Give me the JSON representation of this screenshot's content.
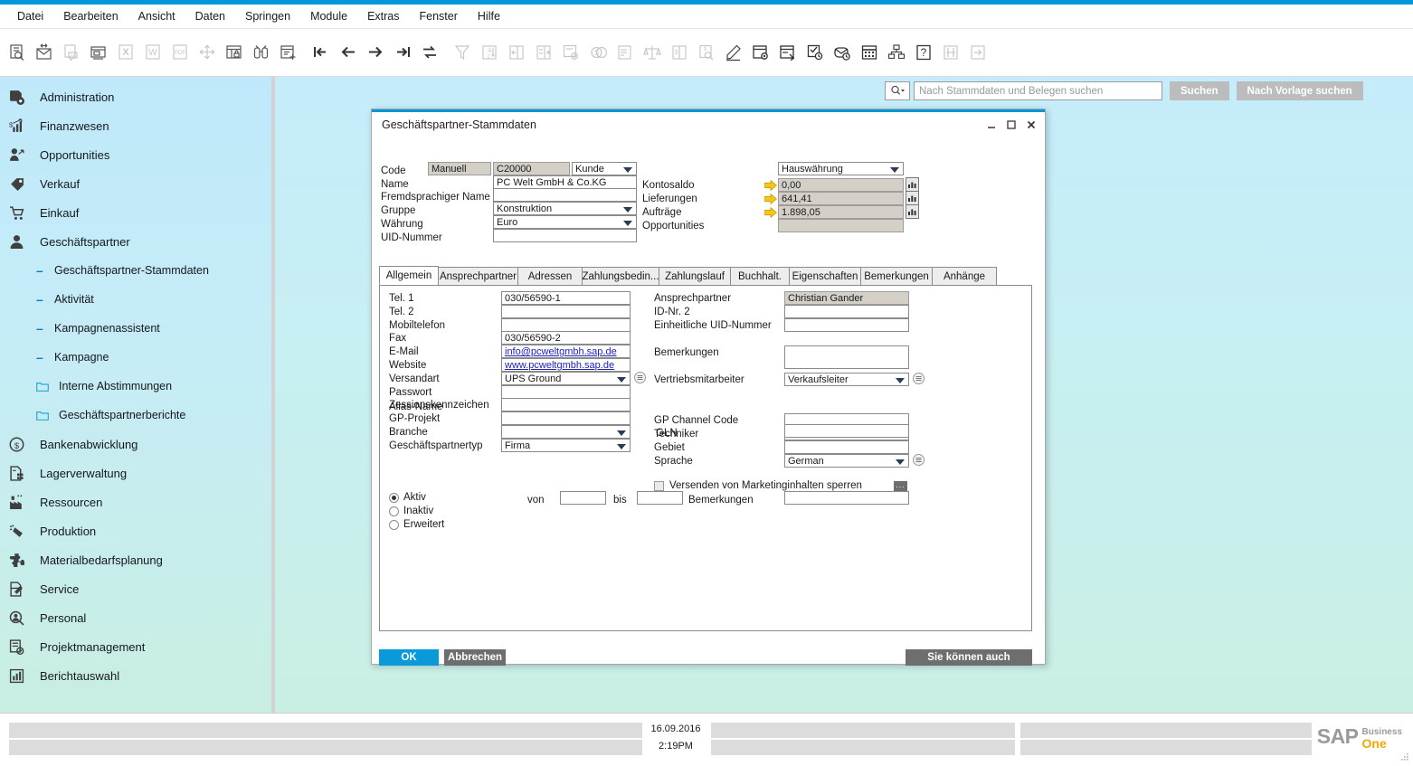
{
  "menubar": {
    "items": [
      "Datei",
      "Bearbeiten",
      "Ansicht",
      "Daten",
      "Springen",
      "Module",
      "Extras",
      "Fenster",
      "Hilfe"
    ]
  },
  "toolbar": {
    "icons": [
      {
        "name": "find-document-icon",
        "enabled": true
      },
      {
        "name": "mail-move-icon",
        "enabled": true
      },
      {
        "name": "message-document-icon",
        "enabled": false
      },
      {
        "name": "layers-window-icon",
        "enabled": true
      },
      {
        "name": "export-excel-icon",
        "enabled": false
      },
      {
        "name": "export-word-icon",
        "enabled": false
      },
      {
        "name": "export-pdf-icon",
        "enabled": false
      },
      {
        "name": "move-arrows-icon",
        "enabled": false
      },
      {
        "name": "lock-window-icon",
        "enabled": true
      },
      {
        "name": "binoculars-icon",
        "enabled": true
      },
      {
        "name": "add-document-icon",
        "enabled": true
      },
      {
        "name": "first-record-icon",
        "enabled": true
      },
      {
        "name": "previous-record-icon",
        "enabled": true
      },
      {
        "name": "next-record-icon",
        "enabled": true
      },
      {
        "name": "last-record-icon",
        "enabled": true
      },
      {
        "name": "refresh-swap-icon",
        "enabled": true
      },
      {
        "name": "filter-funnel-icon",
        "enabled": false
      },
      {
        "name": "sort-az-icon",
        "enabled": false
      },
      {
        "name": "insert-column-left-icon",
        "enabled": false
      },
      {
        "name": "insert-column-right-icon",
        "enabled": false
      },
      {
        "name": "document-currency-icon",
        "enabled": false
      },
      {
        "name": "currency-coins-icon",
        "enabled": false
      },
      {
        "name": "gross-profit-icon",
        "enabled": false
      },
      {
        "name": "balance-scale-icon",
        "enabled": false
      },
      {
        "name": "split-currency-icon",
        "enabled": false
      },
      {
        "name": "document-search-currency-icon",
        "enabled": false
      },
      {
        "name": "edit-pencil-icon",
        "enabled": true
      },
      {
        "name": "form-settings-icon",
        "enabled": true
      },
      {
        "name": "user-defined-values-icon",
        "enabled": true
      },
      {
        "name": "approval-check-icon",
        "enabled": true
      },
      {
        "name": "message-alert-icon",
        "enabled": true
      },
      {
        "name": "calendar-icon",
        "enabled": true
      },
      {
        "name": "org-chart-icon",
        "enabled": true
      },
      {
        "name": "help-question-icon",
        "enabled": true
      },
      {
        "name": "column-settings-icon",
        "enabled": false
      },
      {
        "name": "logout-arrow-icon",
        "enabled": false
      }
    ]
  },
  "sidebar": {
    "items": [
      {
        "label": "Administration",
        "icon": "administration-icon",
        "level": 0
      },
      {
        "label": "Finanzwesen",
        "icon": "financials-icon",
        "level": 0
      },
      {
        "label": "Opportunities",
        "icon": "opportunities-icon",
        "level": 0
      },
      {
        "label": "Verkauf",
        "icon": "sales-icon",
        "level": 0
      },
      {
        "label": "Einkauf",
        "icon": "purchasing-cart-icon",
        "level": 0
      },
      {
        "label": "Geschäftspartner",
        "icon": "business-partner-icon",
        "level": 0
      },
      {
        "label": "Geschäftspartner-Stammdaten",
        "icon": "dash-icon",
        "level": 1
      },
      {
        "label": "Aktivität",
        "icon": "dash-icon",
        "level": 1
      },
      {
        "label": "Kampagnenassistent",
        "icon": "dash-icon",
        "level": 1
      },
      {
        "label": "Kampagne",
        "icon": "dash-icon",
        "level": 1
      },
      {
        "label": "Interne Abstimmungen",
        "icon": "folder-icon",
        "level": 1
      },
      {
        "label": "Geschäftspartnerberichte",
        "icon": "folder-icon",
        "level": 1
      },
      {
        "label": "Bankenabwicklung",
        "icon": "banking-dollar-icon",
        "level": 0
      },
      {
        "label": "Lagerverwaltung",
        "icon": "inventory-icon",
        "level": 0
      },
      {
        "label": "Ressourcen",
        "icon": "resources-factory-icon",
        "level": 0
      },
      {
        "label": "Produktion",
        "icon": "production-icon",
        "level": 0
      },
      {
        "label": "Materialbedarfsplanung",
        "icon": "mrp-puzzle-icon",
        "level": 0
      },
      {
        "label": "Service",
        "icon": "service-wrench-icon",
        "level": 0
      },
      {
        "label": "Personal",
        "icon": "human-resources-icon",
        "level": 0
      },
      {
        "label": "Projektmanagement",
        "icon": "project-management-icon",
        "level": 0
      },
      {
        "label": "Berichtauswahl",
        "icon": "reports-bar-icon",
        "level": 0
      }
    ]
  },
  "search": {
    "icon": "search-dropdown-icon",
    "placeholder": "Nach Stammdaten und Belegen suchen",
    "value": "",
    "search_button": "Suchen",
    "template_button": "Nach Vorlage suchen"
  },
  "dialog": {
    "title": "Geschäftspartner-Stammdaten",
    "controls": {
      "minimize": "minimize-icon",
      "maximize": "maximize-icon",
      "close": "close-icon"
    },
    "header": {
      "code_label": "Code",
      "code_mode": "Manuell",
      "code_value": "C20000",
      "partner_type": "Kunde",
      "name_label": "Name",
      "name_value": "PC Welt GmbH & Co.KG",
      "foreign_name_label": "Fremdsprachiger Name",
      "foreign_name_value": "",
      "group_label": "Gruppe",
      "group_value": "Konstruktion",
      "currency_label": "Währung",
      "currency_value": "Euro",
      "vat_label": "UID-Nummer",
      "vat_value": "",
      "currency_view": "Hauswährung",
      "balances": [
        {
          "label": "Kontosaldo",
          "value": "0,00",
          "has_arrow": true,
          "has_chart": true
        },
        {
          "label": "Lieferungen",
          "value": "641,41",
          "has_arrow": true,
          "has_chart": true
        },
        {
          "label": "Aufträge",
          "value": "1.898,05",
          "has_arrow": true,
          "has_chart": true
        },
        {
          "label": "Opportunities",
          "value": "",
          "has_arrow": false,
          "has_chart": false
        }
      ]
    },
    "tabs": [
      {
        "label": "Allgemein",
        "active": true
      },
      {
        "label": "Ansprechpartner",
        "active": false
      },
      {
        "label": "Adressen",
        "active": false
      },
      {
        "label": "Zahlungsbedin...",
        "active": false
      },
      {
        "label": "Zahlungslauf",
        "active": false
      },
      {
        "label": "Buchhalt.",
        "active": false
      },
      {
        "label": "Eigenschaften",
        "active": false
      },
      {
        "label": "Bemerkungen",
        "active": false
      },
      {
        "label": "Anhänge",
        "active": false
      }
    ],
    "general": {
      "left_fields": [
        {
          "label": "Tel. 1",
          "value": "030/56590-1",
          "type": "text"
        },
        {
          "label": "Tel. 2",
          "value": "",
          "type": "text"
        },
        {
          "label": "Mobiltelefon",
          "value": "",
          "type": "text"
        },
        {
          "label": "Fax",
          "value": "030/56590-2",
          "type": "text"
        },
        {
          "label": "E-Mail",
          "value": "info@pcweltgmbh.sap.de",
          "type": "link"
        },
        {
          "label": "Website",
          "value": "www.pcweltgmbh.sap.de",
          "type": "link"
        },
        {
          "label": "Versandart",
          "value": "UPS Ground",
          "type": "combo-opt"
        },
        {
          "label": "Passwort",
          "value": "",
          "type": "text"
        },
        {
          "label": "Zessionskennzeichen",
          "value": "",
          "type": "split"
        },
        {
          "label": "GP-Projekt",
          "value": "",
          "type": "text"
        },
        {
          "label": "Branche",
          "value": "",
          "type": "combo"
        },
        {
          "label": "Geschäftspartnertyp",
          "value": "Firma",
          "type": "combo"
        }
      ],
      "right_fields": [
        {
          "label": "Ansprechpartner",
          "value": "Christian Gander",
          "type": "readonly"
        },
        {
          "label": "ID-Nr. 2",
          "value": "",
          "type": "text"
        },
        {
          "label": "Einheitliche UID-Nummer",
          "value": "",
          "type": "text"
        },
        {
          "label": "Bemerkungen",
          "value": "",
          "type": "textarea"
        },
        {
          "label": "Vertriebsmitarbeiter",
          "value": "Verkaufsleiter",
          "type": "combo-opt"
        },
        {
          "label": "GP Channel Code",
          "value": "",
          "type": "text"
        },
        {
          "label": "Techniker",
          "value": "",
          "type": "text"
        },
        {
          "label": "Gebiet",
          "value": "",
          "type": "text"
        },
        {
          "label": "Sprache",
          "value": "German",
          "type": "combo-opt"
        }
      ],
      "alias_label": "Alias-Name",
      "alias_value": "",
      "gln_label": "GLN",
      "gln_value": "",
      "block_marketing_label": "Versenden von Marketinginhalten sperren",
      "block_marketing_checked": false,
      "ellipsis_label": "...",
      "status_options": [
        {
          "label": "Aktiv",
          "selected": true
        },
        {
          "label": "Inaktiv",
          "selected": false
        },
        {
          "label": "Erweitert",
          "selected": false
        }
      ],
      "from_label": "von",
      "from_value": "",
      "to_label": "bis",
      "to_value": "",
      "remarks_label": "Bemerkungen",
      "remarks_value": ""
    },
    "footer": {
      "ok": "OK",
      "cancel": "Abbrechen",
      "you_can_also": "Sie können auch"
    }
  },
  "statusbar": {
    "date": "16.09.2016",
    "time": "2:19PM",
    "logo": {
      "sap": "SAP",
      "business": "Business",
      "one": "One"
    }
  },
  "colors": {
    "accent_blue": "#0098d8",
    "ok_button": "#0a9ada",
    "grey_button": "#6e6e6e",
    "sidebar_top": "#bfe9fa",
    "sidebar_bottom": "#c8eee2",
    "arrow_yellow": "#f5c518",
    "sap_orange": "#f0a800"
  }
}
